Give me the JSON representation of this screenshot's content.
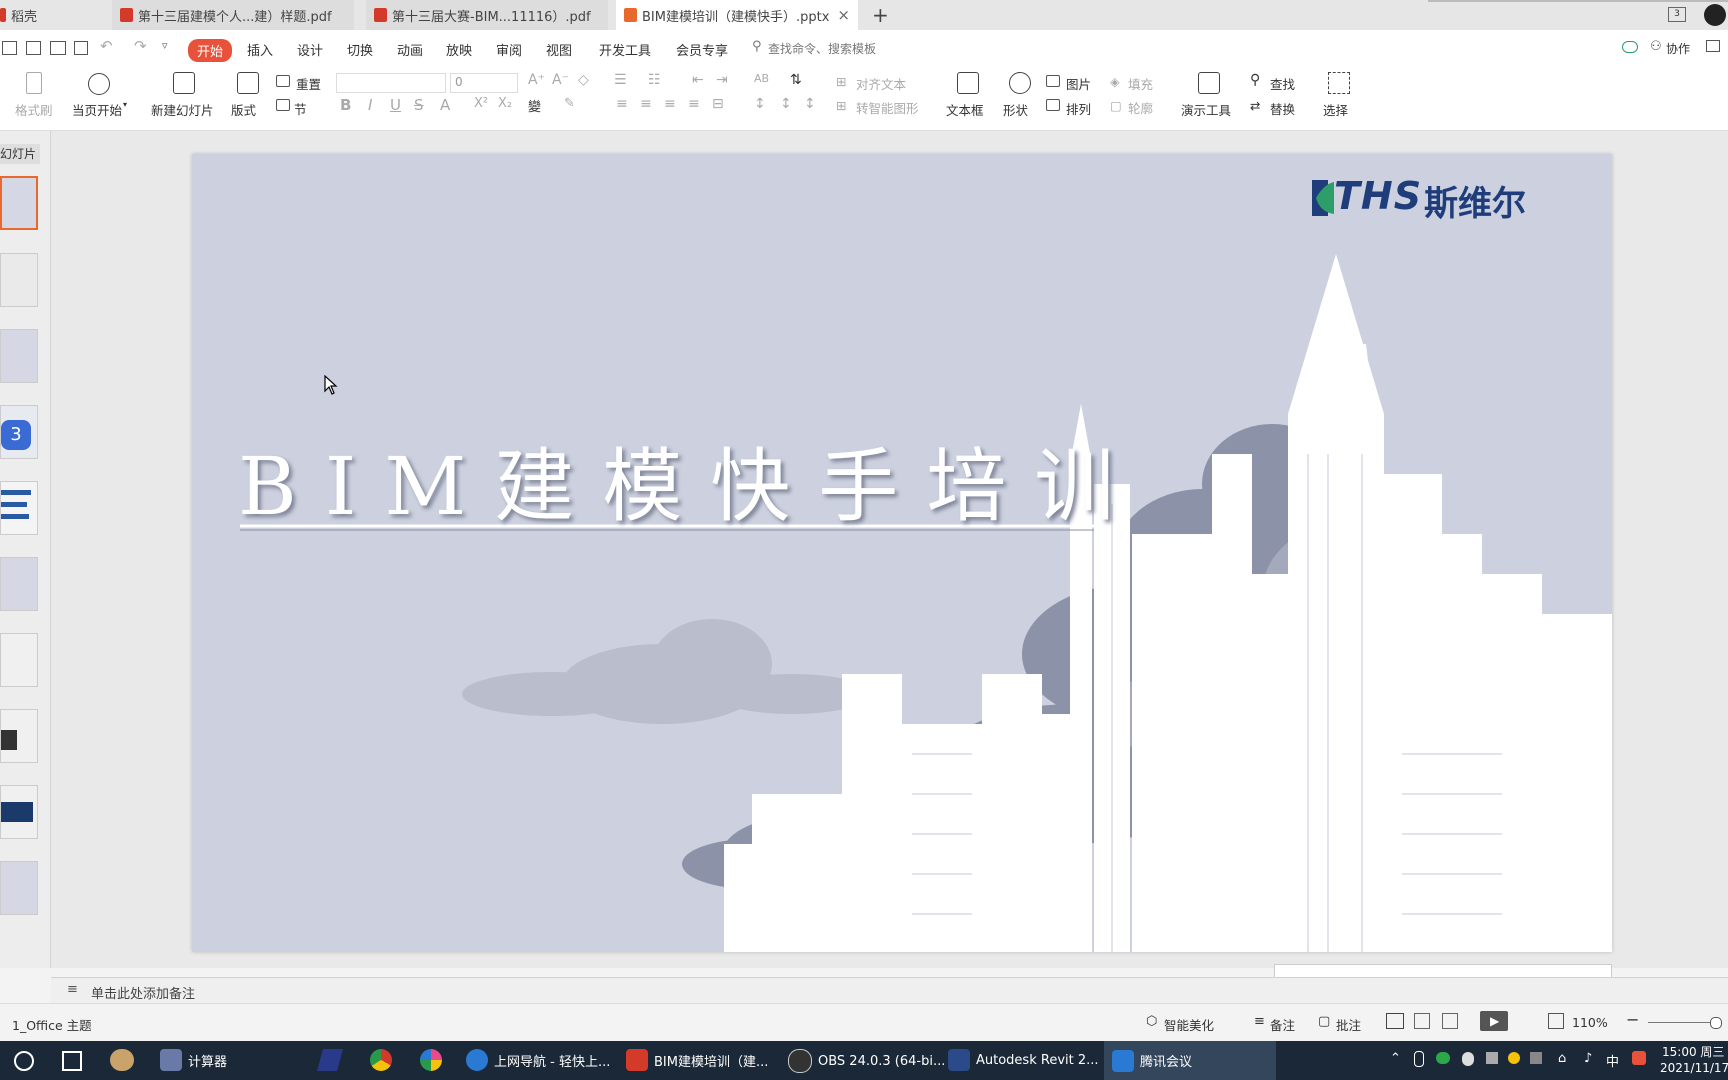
{
  "tabs": [
    {
      "label": "稻壳",
      "color": "#d43a2a"
    },
    {
      "label": "第十三届建模个人...建）样题.pdf",
      "color": "#d43a2a"
    },
    {
      "label": "第十三届大赛-BIM...11116）.pdf",
      "color": "#d43a2a"
    },
    {
      "label": "BIM建模培训（建模快手）.pptx",
      "color": "#e8692e",
      "close": "×"
    }
  ],
  "new_tab": "+",
  "window_badge": "3",
  "menu": {
    "items": [
      "开始",
      "插入",
      "设计",
      "切换",
      "动画",
      "放映",
      "审阅",
      "视图",
      "开发工具",
      "会员专享"
    ],
    "search_placeholder": "查找命令、搜索模板",
    "collab": "协作"
  },
  "ribbon": {
    "format_brush": "格式刷",
    "play_from_current": "当页开始",
    "new_slide": "新建幻灯片",
    "layout": "版式",
    "reset": "重置",
    "section": "节",
    "font_size": "0",
    "align_text": "对齐文本",
    "smart_shape": "转智能图形",
    "textbox": "文本框",
    "shape": "形状",
    "picture": "图片",
    "arrange": "排列",
    "fill": "填充",
    "outline": "轮廓",
    "present_tools": "演示工具",
    "find": "查找",
    "replace": "替换",
    "select": "选择"
  },
  "left_pane": {
    "header": "幻灯片",
    "slide_count": 10,
    "selected": 1
  },
  "slide": {
    "logo_text": "THS",
    "logo_cn": "斯维尔",
    "title": "BIM建模快手培训",
    "colors": {
      "bg": "#cdd1df",
      "logo": "#1e3d7a",
      "accent": "#2d9e6a"
    }
  },
  "notes_placeholder": "单击此处添加备注",
  "status": {
    "theme": "1_Office 主题",
    "beautify": "智能美化",
    "notes": "备注",
    "comments": "批注",
    "zoom": "110%"
  },
  "taskbar": {
    "apps": [
      {
        "label": "计算器",
        "color": "#6a7aa8"
      },
      {
        "label": "上网导航 - 轻快上...",
        "color": "#2a7ad4"
      },
      {
        "label": "BIM建模培训（建...",
        "color": "#d43a2a"
      },
      {
        "label": "OBS 24.0.3 (64-bi...",
        "color": "#333333"
      },
      {
        "label": "Autodesk Revit 2...",
        "color": "#2a4a8a"
      },
      {
        "label": "腾讯会议",
        "color": "#2a7ad4"
      }
    ],
    "ime": "中",
    "time": "15:00 周三",
    "date": "2021/11/17"
  }
}
